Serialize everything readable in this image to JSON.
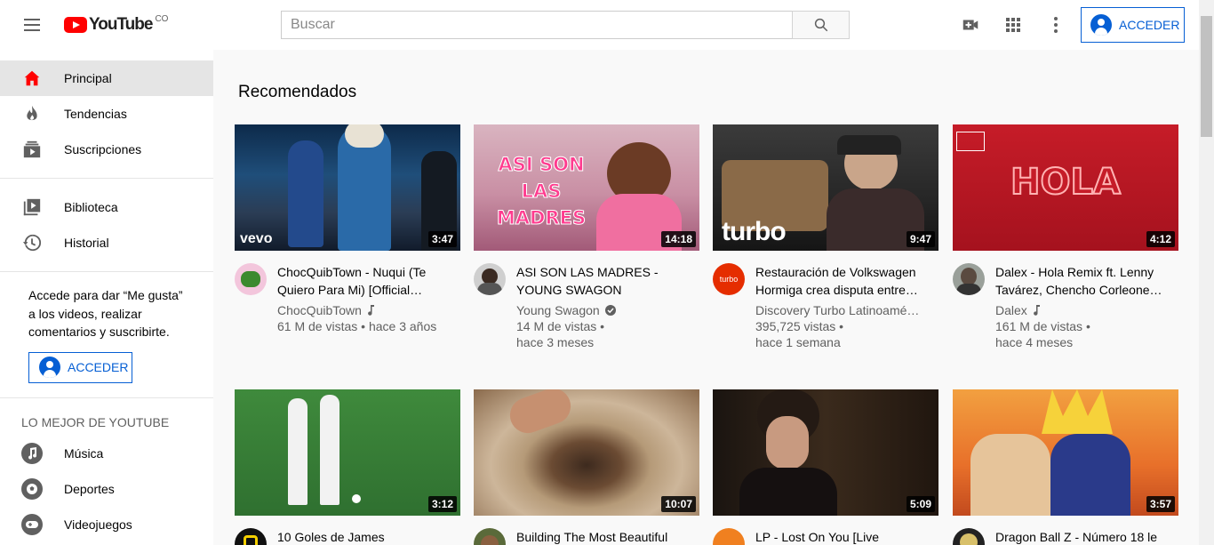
{
  "header": {
    "logo_text": "YouTube",
    "country_code": "CO",
    "search_placeholder": "Buscar",
    "signin_label": "ACCEDER",
    "colors": {
      "brand_red": "#ff0000",
      "accent_blue": "#065fd4"
    }
  },
  "sidebar": {
    "main_items": [
      {
        "label": "Principal",
        "icon": "home-icon",
        "active": true
      },
      {
        "label": "Tendencias",
        "icon": "fire-icon"
      },
      {
        "label": "Suscripciones",
        "icon": "subscriptions-icon"
      }
    ],
    "library_items": [
      {
        "label": "Biblioteca",
        "icon": "library-icon"
      },
      {
        "label": "Historial",
        "icon": "history-icon"
      }
    ],
    "signin_prompt": "Accede para dar “Me gusta” a los videos, realizar comentarios y suscribirte.",
    "signin_label": "ACCEDER",
    "best_of_title": "LO MEJOR DE YOUTUBE",
    "best_of_items": [
      {
        "label": "Música",
        "icon": "music-icon"
      },
      {
        "label": "Deportes",
        "icon": "sports-icon"
      },
      {
        "label": "Videojuegos",
        "icon": "gaming-icon"
      }
    ]
  },
  "main": {
    "section_title": "Recomendados",
    "videos": [
      {
        "title": "ChocQuibTown - Nuqui (Te Quiero Para Mi) [Official…",
        "channel": "ChocQuibTown",
        "badge": "music-note-icon",
        "views": "61 M de vistas • hace 3 años",
        "age": "",
        "duration": "3:47",
        "thumb_text": "vevo"
      },
      {
        "title": "ASI SON LAS MADRES - YOUNG SWAGON",
        "channel": "Young Swagon",
        "badge": "verified-icon",
        "views": "14 M de vistas •",
        "age": "hace 3 meses",
        "duration": "14:18",
        "thumb_text": "ASI SON LAS MADRES"
      },
      {
        "title": "Restauración de Volkswagen Hormiga crea disputa entre…",
        "channel": "Discovery Turbo Latinoamé…",
        "badge": "",
        "views": "395,725 vistas •",
        "age": "hace 1 semana",
        "duration": "9:47",
        "thumb_text": "turbo"
      },
      {
        "title": "Dalex - Hola Remix ft. Lenny Tavárez, Chencho Corleone…",
        "channel": "Dalex",
        "badge": "music-note-icon",
        "views": "161 M de vistas •",
        "age": "hace 4 meses",
        "duration": "4:12",
        "thumb_text": "HOLA"
      },
      {
        "title": "10 Goles de James",
        "channel": "",
        "badge": "",
        "views": "",
        "age": "",
        "duration": "3:12",
        "thumb_text": ""
      },
      {
        "title": "Building The Most Beautiful",
        "channel": "",
        "badge": "",
        "views": "",
        "age": "",
        "duration": "10:07",
        "thumb_text": ""
      },
      {
        "title": "LP - Lost On You [Live",
        "channel": "",
        "badge": "",
        "views": "",
        "age": "",
        "duration": "5:09",
        "thumb_text": ""
      },
      {
        "title": "Dragon Ball Z - Número 18 le",
        "channel": "",
        "badge": "",
        "views": "",
        "age": "",
        "duration": "3:57",
        "thumb_text": ""
      }
    ]
  }
}
